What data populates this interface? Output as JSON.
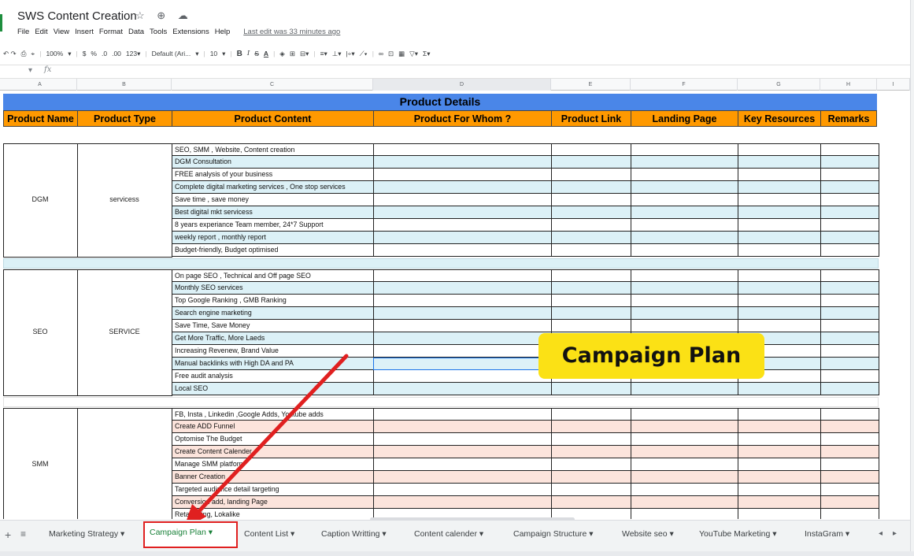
{
  "document": {
    "title": "SWS Content Creation",
    "title_icons": "☆ ⊕ ☁",
    "menu": [
      "File",
      "Edit",
      "View",
      "Insert",
      "Format",
      "Data",
      "Tools",
      "Extensions",
      "Help"
    ],
    "last_edit": "Last edit was 33 minutes ago"
  },
  "toolbar": {
    "undo_redo": "↶ ↷",
    "print": "⎙",
    "paint": "⌖",
    "zoom": "100%",
    "zoom_caret": "▾",
    "currency": "$",
    "percent": "%",
    "dec_less": ".0",
    "dec_more": ".00",
    "format_more": "123▾",
    "font": "Default (Ari...",
    "font_caret": "▾",
    "font_size": "10",
    "size_caret": "▾",
    "bold": "B",
    "italic": "I",
    "strike": "S",
    "text_color": "A",
    "fill": "◈",
    "borders": "⊞",
    "merge": "⊟▾",
    "align": "≡▾",
    "valign": "⊥▾",
    "wrap": "|÷▾",
    "rotate": "⟋▾",
    "link": "∞",
    "comment": "⊡",
    "chart": "▦",
    "filter": "▽▾",
    "functions": "Σ▾"
  },
  "formula_bar": {
    "cell_ref": "▾",
    "fx": "fx",
    "value": ""
  },
  "columns": [
    "A",
    "B",
    "C",
    "D",
    "E",
    "F",
    "G",
    "H",
    "I"
  ],
  "sheet": {
    "banner": "Product Details",
    "headers": [
      "Product Name",
      "Product Type",
      "Product Content",
      "Product For Whom ?",
      "Product Link",
      "Landing Page",
      "Key Resources",
      "Remarks"
    ],
    "blocks": [
      {
        "name": "DGM",
        "type": "servicess",
        "rows": [
          "SEO, SMM , Website, Content creation",
          "DGM Consultation",
          "FREE analysis of your business",
          "Complete digital marketing services , One stop services",
          "Save time , save money",
          "Best digital mkt servicess",
          "8 years experiance Team member, 24*7 Support",
          "weekly report , monthly report",
          "Budget-friendly, Budget optimised"
        ]
      },
      {
        "name": "SEO",
        "type": "SERVICE",
        "rows": [
          "On page SEO , Technical and Off page SEO",
          "Monthly SEO services",
          "Top Google Ranking , GMB Ranking",
          "Search engine marketing",
          "Save Time, Save Money",
          "Get More Traffic, More Laeds",
          "Increasing Revenew, Brand Value",
          "Manual backlinks with High DA and PA",
          "Free audit analysis",
          "Local SEO"
        ]
      },
      {
        "name": "SMM",
        "type": "",
        "rows": [
          "FB, Insta , Linkedin ,Google Adds, Youtube adds",
          "Create ADD Funnel",
          "Optomise The Budget",
          "Create Content Calender",
          "Manage SMM platform",
          "Banner Creation",
          "Targeted audiance detail targeting",
          "Conversion add, landing Page",
          "Retargeting, Lokalike"
        ]
      }
    ]
  },
  "overlay": {
    "label": "Campaign Plan"
  },
  "tabs": {
    "add": "+",
    "all": "≡",
    "items": [
      "Marketing Strategy ▾",
      "Campaign Plan ▾",
      "Content List ▾",
      "Caption Writting ▾",
      "Content calender ▾",
      "Campaign Structure ▾",
      "Website seo ▾",
      "YouTube Marketing ▾",
      "InstaGram ▾"
    ],
    "active_index": 1,
    "prev": "◂",
    "next": "▸"
  },
  "colors": {
    "banner": "#4a86e8",
    "header": "#ff9900",
    "row_blue": "#dcf1f7",
    "row_pink": "#fce4dc",
    "overlay": "#fbe115",
    "arrow": "#e02020",
    "active_tab_text": "#188038"
  }
}
